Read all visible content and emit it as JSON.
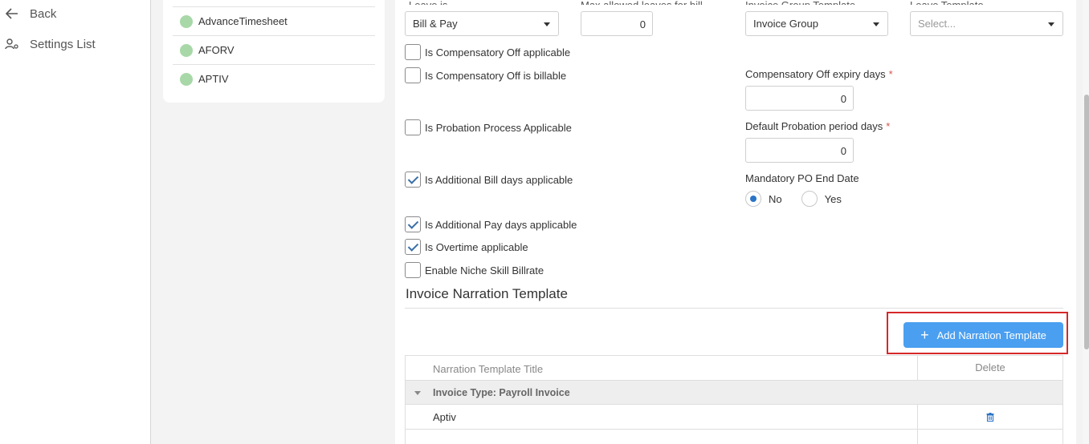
{
  "nav": {
    "back": "Back",
    "settings_list": "Settings List"
  },
  "clients": [
    "AdvanceTimesheet",
    "AFORV",
    "APTIV"
  ],
  "top_labels": {
    "leave_is": "Leave is",
    "max_allowed_leaves": "Max allowed leaves for bill",
    "invoice_group_template": "Invoice Group Template",
    "leave_template": "Leave Template"
  },
  "leave_is_value": "Bill & Pay",
  "max_leaves_value": "0",
  "invoice_group_value": "Invoice Group",
  "leave_template_placeholder": "Select...",
  "checkboxes": {
    "comp_off_applicable": {
      "label": "Is Compensatory Off applicable",
      "checked": false
    },
    "comp_off_billable": {
      "label": "Is Compensatory Off is billable",
      "checked": false
    },
    "probation_applicable": {
      "label": "Is Probation Process Applicable",
      "checked": false
    },
    "additional_bill_days": {
      "label": "Is Additional Bill days applicable",
      "checked": true
    },
    "additional_pay_days": {
      "label": "Is Additional Pay days applicable",
      "checked": true
    },
    "overtime": {
      "label": "Is Overtime applicable",
      "checked": true
    },
    "niche_skill": {
      "label": "Enable Niche Skill Billrate",
      "checked": false
    }
  },
  "comp_off_expiry": {
    "label": "Compensatory Off expiry days",
    "required_mark": "*",
    "value": "0"
  },
  "probation_days": {
    "label": "Default Probation period days",
    "required_mark": "*",
    "value": "0"
  },
  "mandatory_po": {
    "label": "Mandatory PO End Date",
    "options": [
      "No",
      "Yes"
    ],
    "selected": "No"
  },
  "narration": {
    "section_title": "Invoice Narration Template",
    "add_button": "Add Narration Template",
    "add_button_icon": "plus-icon",
    "columns": [
      "Narration Template Title",
      "Delete"
    ],
    "group_label": "Invoice Type: Payroll Invoice",
    "rows": [
      {
        "title": "Aptiv"
      }
    ],
    "delete_icon": "trash-icon"
  },
  "colors": {
    "primary_button": "#4a9ff0",
    "highlight": "#d62828",
    "client_dot": "#a8d8a8",
    "required": "#d9534f"
  }
}
